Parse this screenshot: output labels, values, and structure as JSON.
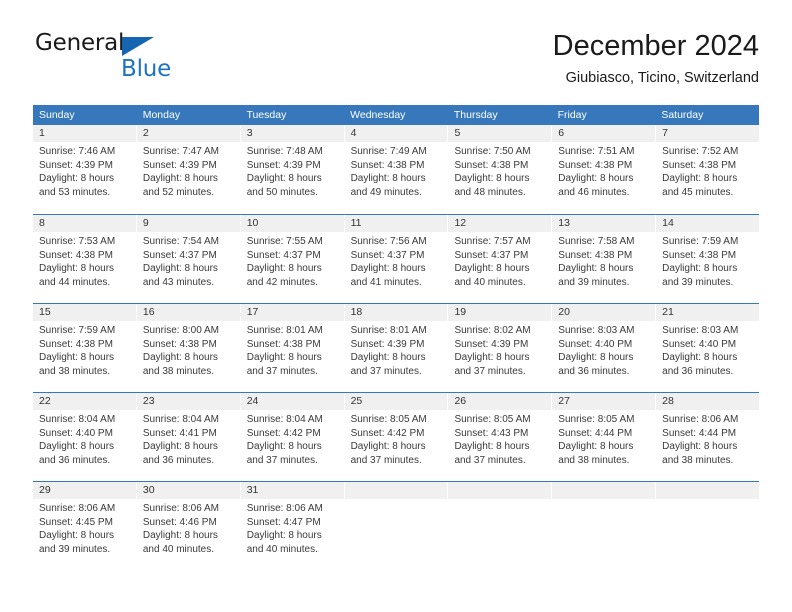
{
  "brand": {
    "name_part1": "General",
    "name_part2": "Blue",
    "accent_color": "#1c72c4",
    "triangle_color": "#1565b0"
  },
  "header": {
    "title": "December 2024",
    "location": "Giubiasco, Ticino, Switzerland"
  },
  "calendar": {
    "header_bg": "#3778bc",
    "day_number_bg": "#f0f0f0",
    "weekdays": [
      "Sunday",
      "Monday",
      "Tuesday",
      "Wednesday",
      "Thursday",
      "Friday",
      "Saturday"
    ],
    "weeks": [
      [
        {
          "day": "1",
          "lines": [
            "Sunrise: 7:46 AM",
            "Sunset: 4:39 PM",
            "Daylight: 8 hours",
            "and 53 minutes."
          ]
        },
        {
          "day": "2",
          "lines": [
            "Sunrise: 7:47 AM",
            "Sunset: 4:39 PM",
            "Daylight: 8 hours",
            "and 52 minutes."
          ]
        },
        {
          "day": "3",
          "lines": [
            "Sunrise: 7:48 AM",
            "Sunset: 4:39 PM",
            "Daylight: 8 hours",
            "and 50 minutes."
          ]
        },
        {
          "day": "4",
          "lines": [
            "Sunrise: 7:49 AM",
            "Sunset: 4:38 PM",
            "Daylight: 8 hours",
            "and 49 minutes."
          ]
        },
        {
          "day": "5",
          "lines": [
            "Sunrise: 7:50 AM",
            "Sunset: 4:38 PM",
            "Daylight: 8 hours",
            "and 48 minutes."
          ]
        },
        {
          "day": "6",
          "lines": [
            "Sunrise: 7:51 AM",
            "Sunset: 4:38 PM",
            "Daylight: 8 hours",
            "and 46 minutes."
          ]
        },
        {
          "day": "7",
          "lines": [
            "Sunrise: 7:52 AM",
            "Sunset: 4:38 PM",
            "Daylight: 8 hours",
            "and 45 minutes."
          ]
        }
      ],
      [
        {
          "day": "8",
          "lines": [
            "Sunrise: 7:53 AM",
            "Sunset: 4:38 PM",
            "Daylight: 8 hours",
            "and 44 minutes."
          ]
        },
        {
          "day": "9",
          "lines": [
            "Sunrise: 7:54 AM",
            "Sunset: 4:37 PM",
            "Daylight: 8 hours",
            "and 43 minutes."
          ]
        },
        {
          "day": "10",
          "lines": [
            "Sunrise: 7:55 AM",
            "Sunset: 4:37 PM",
            "Daylight: 8 hours",
            "and 42 minutes."
          ]
        },
        {
          "day": "11",
          "lines": [
            "Sunrise: 7:56 AM",
            "Sunset: 4:37 PM",
            "Daylight: 8 hours",
            "and 41 minutes."
          ]
        },
        {
          "day": "12",
          "lines": [
            "Sunrise: 7:57 AM",
            "Sunset: 4:37 PM",
            "Daylight: 8 hours",
            "and 40 minutes."
          ]
        },
        {
          "day": "13",
          "lines": [
            "Sunrise: 7:58 AM",
            "Sunset: 4:38 PM",
            "Daylight: 8 hours",
            "and 39 minutes."
          ]
        },
        {
          "day": "14",
          "lines": [
            "Sunrise: 7:59 AM",
            "Sunset: 4:38 PM",
            "Daylight: 8 hours",
            "and 39 minutes."
          ]
        }
      ],
      [
        {
          "day": "15",
          "lines": [
            "Sunrise: 7:59 AM",
            "Sunset: 4:38 PM",
            "Daylight: 8 hours",
            "and 38 minutes."
          ]
        },
        {
          "day": "16",
          "lines": [
            "Sunrise: 8:00 AM",
            "Sunset: 4:38 PM",
            "Daylight: 8 hours",
            "and 38 minutes."
          ]
        },
        {
          "day": "17",
          "lines": [
            "Sunrise: 8:01 AM",
            "Sunset: 4:38 PM",
            "Daylight: 8 hours",
            "and 37 minutes."
          ]
        },
        {
          "day": "18",
          "lines": [
            "Sunrise: 8:01 AM",
            "Sunset: 4:39 PM",
            "Daylight: 8 hours",
            "and 37 minutes."
          ]
        },
        {
          "day": "19",
          "lines": [
            "Sunrise: 8:02 AM",
            "Sunset: 4:39 PM",
            "Daylight: 8 hours",
            "and 37 minutes."
          ]
        },
        {
          "day": "20",
          "lines": [
            "Sunrise: 8:03 AM",
            "Sunset: 4:40 PM",
            "Daylight: 8 hours",
            "and 36 minutes."
          ]
        },
        {
          "day": "21",
          "lines": [
            "Sunrise: 8:03 AM",
            "Sunset: 4:40 PM",
            "Daylight: 8 hours",
            "and 36 minutes."
          ]
        }
      ],
      [
        {
          "day": "22",
          "lines": [
            "Sunrise: 8:04 AM",
            "Sunset: 4:40 PM",
            "Daylight: 8 hours",
            "and 36 minutes."
          ]
        },
        {
          "day": "23",
          "lines": [
            "Sunrise: 8:04 AM",
            "Sunset: 4:41 PM",
            "Daylight: 8 hours",
            "and 36 minutes."
          ]
        },
        {
          "day": "24",
          "lines": [
            "Sunrise: 8:04 AM",
            "Sunset: 4:42 PM",
            "Daylight: 8 hours",
            "and 37 minutes."
          ]
        },
        {
          "day": "25",
          "lines": [
            "Sunrise: 8:05 AM",
            "Sunset: 4:42 PM",
            "Daylight: 8 hours",
            "and 37 minutes."
          ]
        },
        {
          "day": "26",
          "lines": [
            "Sunrise: 8:05 AM",
            "Sunset: 4:43 PM",
            "Daylight: 8 hours",
            "and 37 minutes."
          ]
        },
        {
          "day": "27",
          "lines": [
            "Sunrise: 8:05 AM",
            "Sunset: 4:44 PM",
            "Daylight: 8 hours",
            "and 38 minutes."
          ]
        },
        {
          "day": "28",
          "lines": [
            "Sunrise: 8:06 AM",
            "Sunset: 4:44 PM",
            "Daylight: 8 hours",
            "and 38 minutes."
          ]
        }
      ],
      [
        {
          "day": "29",
          "lines": [
            "Sunrise: 8:06 AM",
            "Sunset: 4:45 PM",
            "Daylight: 8 hours",
            "and 39 minutes."
          ]
        },
        {
          "day": "30",
          "lines": [
            "Sunrise: 8:06 AM",
            "Sunset: 4:46 PM",
            "Daylight: 8 hours",
            "and 40 minutes."
          ]
        },
        {
          "day": "31",
          "lines": [
            "Sunrise: 8:06 AM",
            "Sunset: 4:47 PM",
            "Daylight: 8 hours",
            "and 40 minutes."
          ]
        },
        {
          "day": "",
          "lines": []
        },
        {
          "day": "",
          "lines": []
        },
        {
          "day": "",
          "lines": []
        },
        {
          "day": "",
          "lines": []
        }
      ]
    ]
  }
}
